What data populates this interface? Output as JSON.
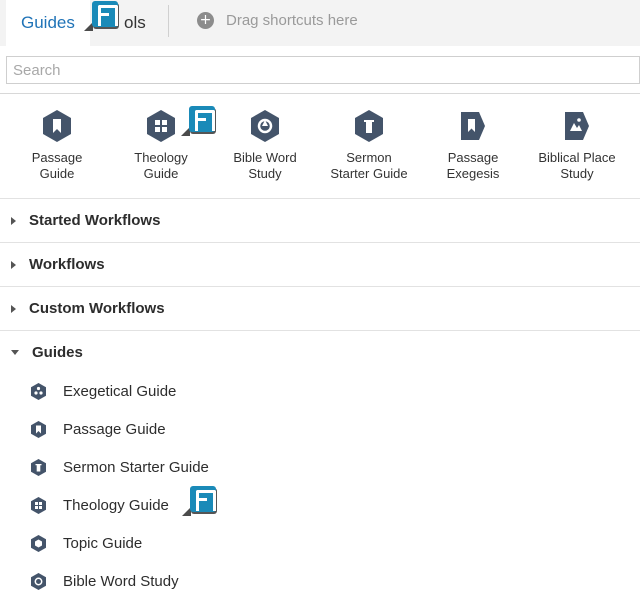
{
  "tabs": [
    {
      "label": "Guides",
      "active": true
    },
    {
      "label": "ols",
      "active": false
    }
  ],
  "drag_hint": "Drag shortcuts here",
  "search": {
    "placeholder": "Search",
    "value": ""
  },
  "shortcuts": [
    {
      "label_line1": "Passage",
      "label_line2": "Guide",
      "icon": "passage-guide-icon"
    },
    {
      "label_line1": "Theology",
      "label_line2": "Guide",
      "icon": "theology-guide-icon"
    },
    {
      "label_line1": "Bible Word",
      "label_line2": "Study",
      "icon": "bible-word-study-icon"
    },
    {
      "label_line1": "Sermon",
      "label_line2": "Starter Guide",
      "icon": "sermon-starter-guide-icon"
    },
    {
      "label_line1": "Passage",
      "label_line2": "Exegesis",
      "icon": "passage-exegesis-icon"
    },
    {
      "label_line1": "Biblical Place",
      "label_line2": "Study",
      "icon": "biblical-place-study-icon"
    }
  ],
  "sections": [
    {
      "label": "Started Workflows",
      "expanded": false
    },
    {
      "label": "Workflows",
      "expanded": false
    },
    {
      "label": "Custom Workflows",
      "expanded": false
    },
    {
      "label": "Guides",
      "expanded": true
    }
  ],
  "guides": [
    {
      "label": "Exegetical Guide",
      "icon": "exegetical-guide-icon"
    },
    {
      "label": "Passage Guide",
      "icon": "passage-guide-icon"
    },
    {
      "label": "Sermon Starter Guide",
      "icon": "sermon-starter-guide-icon"
    },
    {
      "label": "Theology Guide",
      "icon": "theology-guide-icon"
    },
    {
      "label": "Topic Guide",
      "icon": "topic-guide-icon"
    },
    {
      "label": "Bible Word Study",
      "icon": "bible-word-study-icon"
    }
  ],
  "colors": {
    "accent": "#1f73b7",
    "icon_fill": "#44546a",
    "badge": "#1a8ab8"
  }
}
